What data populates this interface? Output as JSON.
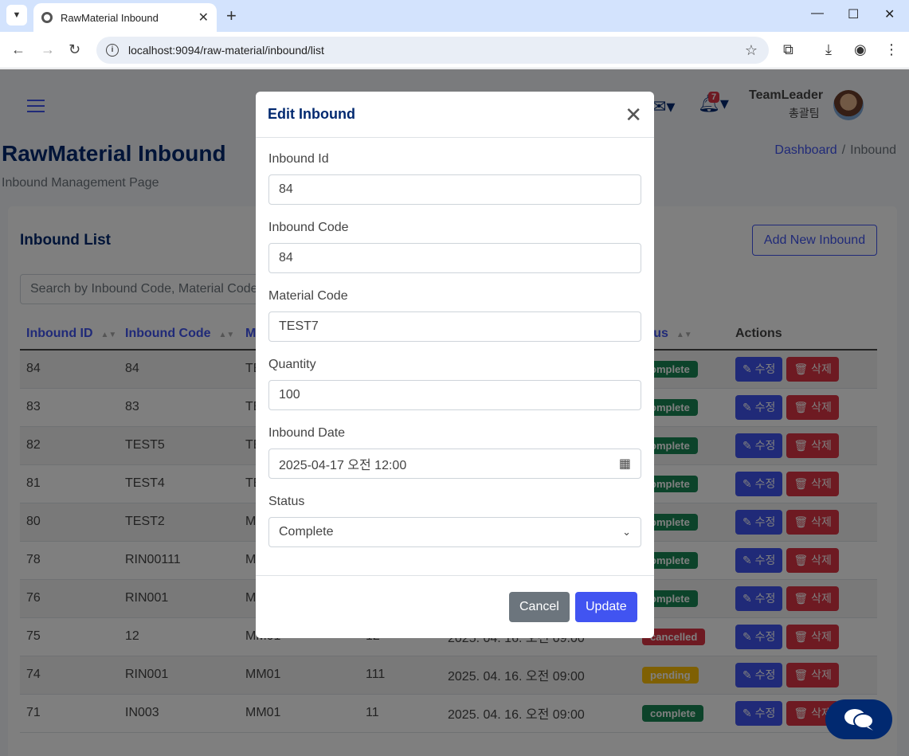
{
  "browser": {
    "tab_title": "RawMaterial Inbound",
    "url": "localhost:9094/raw-material/inbound/list"
  },
  "header": {
    "notification_count": "7",
    "user_name": "TeamLeader",
    "user_team": "총괄팀"
  },
  "page": {
    "title": "RawMaterial Inbound",
    "subtitle": "Inbound Management Page",
    "breadcrumb": [
      "Dashboard",
      "Inbound"
    ]
  },
  "card": {
    "title": "Inbound List",
    "add_button": "Add New Inbound",
    "search_placeholder": "Search by Inbound Code, Material Code"
  },
  "table": {
    "columns": [
      "Inbound ID",
      "Inbound Code",
      "M",
      "",
      "",
      "atus",
      "Actions"
    ],
    "edit_label": "수정",
    "delete_label": "삭제",
    "rows": [
      {
        "id": "84",
        "code": "84",
        "material": "TE",
        "qty": "",
        "date": "",
        "status": "omplete",
        "status_type": "complete"
      },
      {
        "id": "83",
        "code": "83",
        "material": "TE",
        "qty": "",
        "date": "",
        "status": "omplete",
        "status_type": "complete"
      },
      {
        "id": "82",
        "code": "TEST5",
        "material": "TE",
        "qty": "",
        "date": "",
        "status": "omplete",
        "status_type": "complete"
      },
      {
        "id": "81",
        "code": "TEST4",
        "material": "TE",
        "qty": "",
        "date": "",
        "status": "omplete",
        "status_type": "complete"
      },
      {
        "id": "80",
        "code": "TEST2",
        "material": "M",
        "qty": "",
        "date": "",
        "status": "omplete",
        "status_type": "complete"
      },
      {
        "id": "78",
        "code": "RIN00111",
        "material": "M",
        "qty": "",
        "date": "",
        "status": "omplete",
        "status_type": "complete"
      },
      {
        "id": "76",
        "code": "RIN001",
        "material": "M",
        "qty": "",
        "date": "",
        "status": "omplete",
        "status_type": "complete"
      },
      {
        "id": "75",
        "code": "12",
        "material": "MM01",
        "qty": "12",
        "date": "2025. 04. 16. 오전 09:00",
        "status": "cancelled",
        "status_type": "cancelled"
      },
      {
        "id": "74",
        "code": "RIN001",
        "material": "MM01",
        "qty": "111",
        "date": "2025. 04. 16. 오전 09:00",
        "status": "pending",
        "status_type": "pending"
      },
      {
        "id": "71",
        "code": "IN003",
        "material": "MM01",
        "qty": "11",
        "date": "2025. 04. 16. 오전 09:00",
        "status": "complete",
        "status_type": "complete"
      }
    ]
  },
  "modal": {
    "title": "Edit Inbound",
    "fields": [
      {
        "label": "Inbound Id",
        "value": "84"
      },
      {
        "label": "Inbound Code",
        "value": "84"
      },
      {
        "label": "Material Code",
        "value": "TEST7"
      },
      {
        "label": "Quantity",
        "value": "100"
      },
      {
        "label": "Inbound Date",
        "value": "2025-04-17 오전 12:00"
      },
      {
        "label": "Status",
        "value": "Complete"
      }
    ],
    "cancel_label": "Cancel",
    "update_label": "Update"
  },
  "colors": {
    "primary": "#4154f1",
    "navy": "#012970",
    "success": "#198754",
    "danger": "#dc3545",
    "warning": "#ffc107",
    "secondary": "#6c757d"
  }
}
